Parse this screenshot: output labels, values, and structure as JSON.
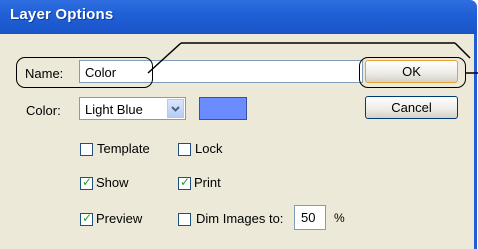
{
  "window": {
    "title": "Layer Options"
  },
  "name_field": {
    "label": "Name:",
    "value": "Color"
  },
  "color_field": {
    "label": "Color:",
    "value": "Light Blue",
    "swatch": "#6b8cff"
  },
  "buttons": {
    "ok": "OK",
    "cancel": "Cancel"
  },
  "options": {
    "template": {
      "label": "Template",
      "checked": false
    },
    "lock": {
      "label": "Lock",
      "checked": false
    },
    "show": {
      "label": "Show",
      "checked": true
    },
    "print": {
      "label": "Print",
      "checked": true
    },
    "preview": {
      "label": "Preview",
      "checked": true
    },
    "dim": {
      "label": "Dim Images to:",
      "checked": false,
      "value": "50",
      "unit": "%"
    }
  },
  "icons": {
    "dropdown": "chevron-down-icon",
    "check": "checkmark-icon"
  }
}
